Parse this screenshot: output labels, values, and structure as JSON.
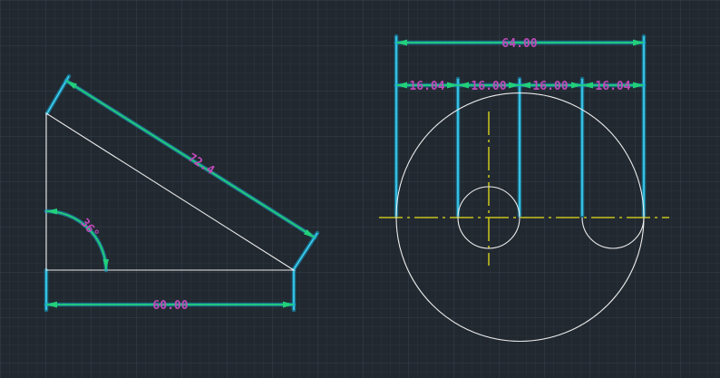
{
  "drawing": {
    "background": "#212830",
    "grid_minor": "#2c343d",
    "grid_major": "#38424d",
    "geometry_color": "#ececec",
    "dimension_color": "#22d07a",
    "extension_color": "#3fd3f5",
    "centerline_color": "#e6e019",
    "text_color": "#c04ab8"
  },
  "dimensions": {
    "slant_length": "72.4",
    "angle": "36°",
    "base_width": "60.00",
    "overall_width": "64.00",
    "segment_1": "16.04",
    "segment_2": "16.00",
    "segment_3": "16.00",
    "segment_4": "16.04"
  }
}
